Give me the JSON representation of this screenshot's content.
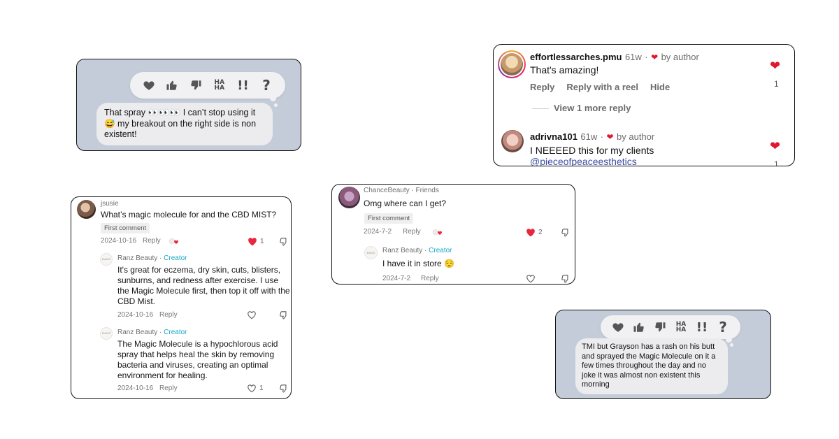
{
  "imessage_1": {
    "tapbacks": [
      "heart-icon",
      "thumbs-up-icon",
      "thumbs-down-icon",
      "haha-icon",
      "exclamation-icon",
      "question-icon"
    ],
    "haha_text": "HA HA",
    "bang_text": "!!",
    "question_text": "?",
    "message": "That spray 👀👀👀 I can’t stop using it 😅 my breakout on the right side is non existent!"
  },
  "imessage_2": {
    "haha_text": "HA HA",
    "bang_text": "!!",
    "question_text": "?",
    "message": "TMI but Grayson has a rash on his butt and sprayed the Magic Molecule on it a few times throughout the day and no joke it was almost non existent this morning"
  },
  "instagram": {
    "comment1": {
      "username": "effortlessarches.pmu",
      "age": "61w",
      "liked_by": "by author",
      "text": "That's amazing!",
      "actions": [
        "Reply",
        "Reply with a reel",
        "Hide"
      ],
      "likes": "1"
    },
    "view_more": "View 1 more reply",
    "comment2": {
      "username": "adrivna101",
      "age": "61w",
      "liked_by": "by author",
      "text": "I NEEEED this for my clients",
      "mention": "@pieceofpeaceesthetics",
      "likes": "1"
    },
    "separator": "·"
  },
  "tiktok_1": {
    "comment": {
      "username": "jsusie",
      "text": "What’s magic molecule for and the CBD MIST?",
      "badge": "First comment",
      "date": "2024-10-16",
      "reply": "Reply",
      "likes": "1"
    },
    "reply1": {
      "username": "Ranz Beauty",
      "role": "Creator",
      "text": "It's great for eczema, dry skin, cuts, blisters, sunburns, and redness after exercise. I use the Magic Molecule first, then top it off with the CBD Mist.",
      "date": "2024-10-16",
      "reply": "Reply"
    },
    "reply2": {
      "username": "Ranz Beauty",
      "role": "Creator",
      "text": "The Magic Molecule is a hypochlorous acid spray that helps heal the skin by removing bacteria and viruses, creating an optimal environment for healing.",
      "date": "2024-10-16",
      "reply": "Reply",
      "likes": "1"
    },
    "logo_text": "RANZ"
  },
  "tiktok_2": {
    "comment": {
      "username": "ChanceBeauty",
      "relation": "Friends",
      "text": "Omg where can I get?",
      "badge": "First comment",
      "date": "2024-7-2",
      "reply": "Reply",
      "likes": "2"
    },
    "reply1": {
      "username": "Ranz Beauty",
      "role": "Creator",
      "text": "I have it in store 😌",
      "date": "2024-7-2",
      "reply": "Reply"
    },
    "logo_text": "RANZ"
  },
  "colors": {
    "imessage_bg": "#c3ccd8",
    "heart_red": "#e0182d",
    "creator_blue": "#1aa7c9",
    "mention_blue": "#3b4fa0"
  }
}
